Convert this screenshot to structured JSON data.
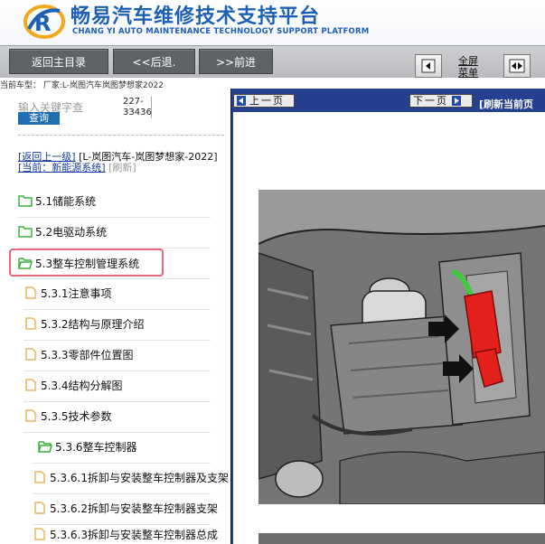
{
  "brand": {
    "title_cn": "畅易汽车维修技术支持平台",
    "title_en": "CHANG YI AUTO MAINTENANCE TECHNOLOGY SUPPORT PLATFORM"
  },
  "nav": {
    "home": "返回主目录",
    "back": "<<后退.",
    "forward": ">>前进",
    "fullscreen": "全屏\n菜单"
  },
  "vehicle_line": "当前车型：  厂家:L-岚图汽车岚图梦想家2022",
  "search": {
    "placeholder": "输入关键字查",
    "button": "查询",
    "code": "227-33436"
  },
  "breadcrumb": {
    "up": "[返回上一级]",
    "path": "[L-岚图汽车-岚图梦想家-2022]",
    "current_label": "[当前：新能源系统]",
    "refresh": "[刷新]"
  },
  "tree": [
    {
      "label": "5.1储能系统",
      "icon": "folder-icon"
    },
    {
      "label": "5.2电驱动系统",
      "icon": "folder-icon"
    },
    {
      "label": "5.3整车控制管理系统",
      "icon": "folder-open-icon"
    },
    {
      "label": "5.3.1注意事项",
      "icon": "document-icon"
    },
    {
      "label": "5.3.2结构与原理介绍",
      "icon": "document-icon"
    },
    {
      "label": "5.3.3零部件位置图",
      "icon": "document-icon"
    },
    {
      "label": "5.3.4结构分解图",
      "icon": "document-icon"
    },
    {
      "label": "5.3.5技术参数",
      "icon": "document-icon"
    },
    {
      "label": "5.3.6整车控制器",
      "icon": "folder-open-icon"
    },
    {
      "label": "5.3.6.1拆卸与安装整车控制器及支架",
      "icon": "document-icon"
    },
    {
      "label": "5.3.6.2拆卸与安装整车控制器支架",
      "icon": "document-icon"
    },
    {
      "label": "5.3.6.3拆卸与安装整车控制器总成",
      "icon": "document-icon"
    }
  ],
  "doc": {
    "prev": "上一页",
    "next": "下一页",
    "refresh": "[刷新当前页"
  },
  "colors": {
    "brand_blue": "#1c5fb6",
    "nav_button": "#5f6368",
    "doc_toolbar": "#24408e",
    "folder_green": "#3bb03b",
    "highlight_red": "#e4687a",
    "connector_red": "#e3201b"
  }
}
